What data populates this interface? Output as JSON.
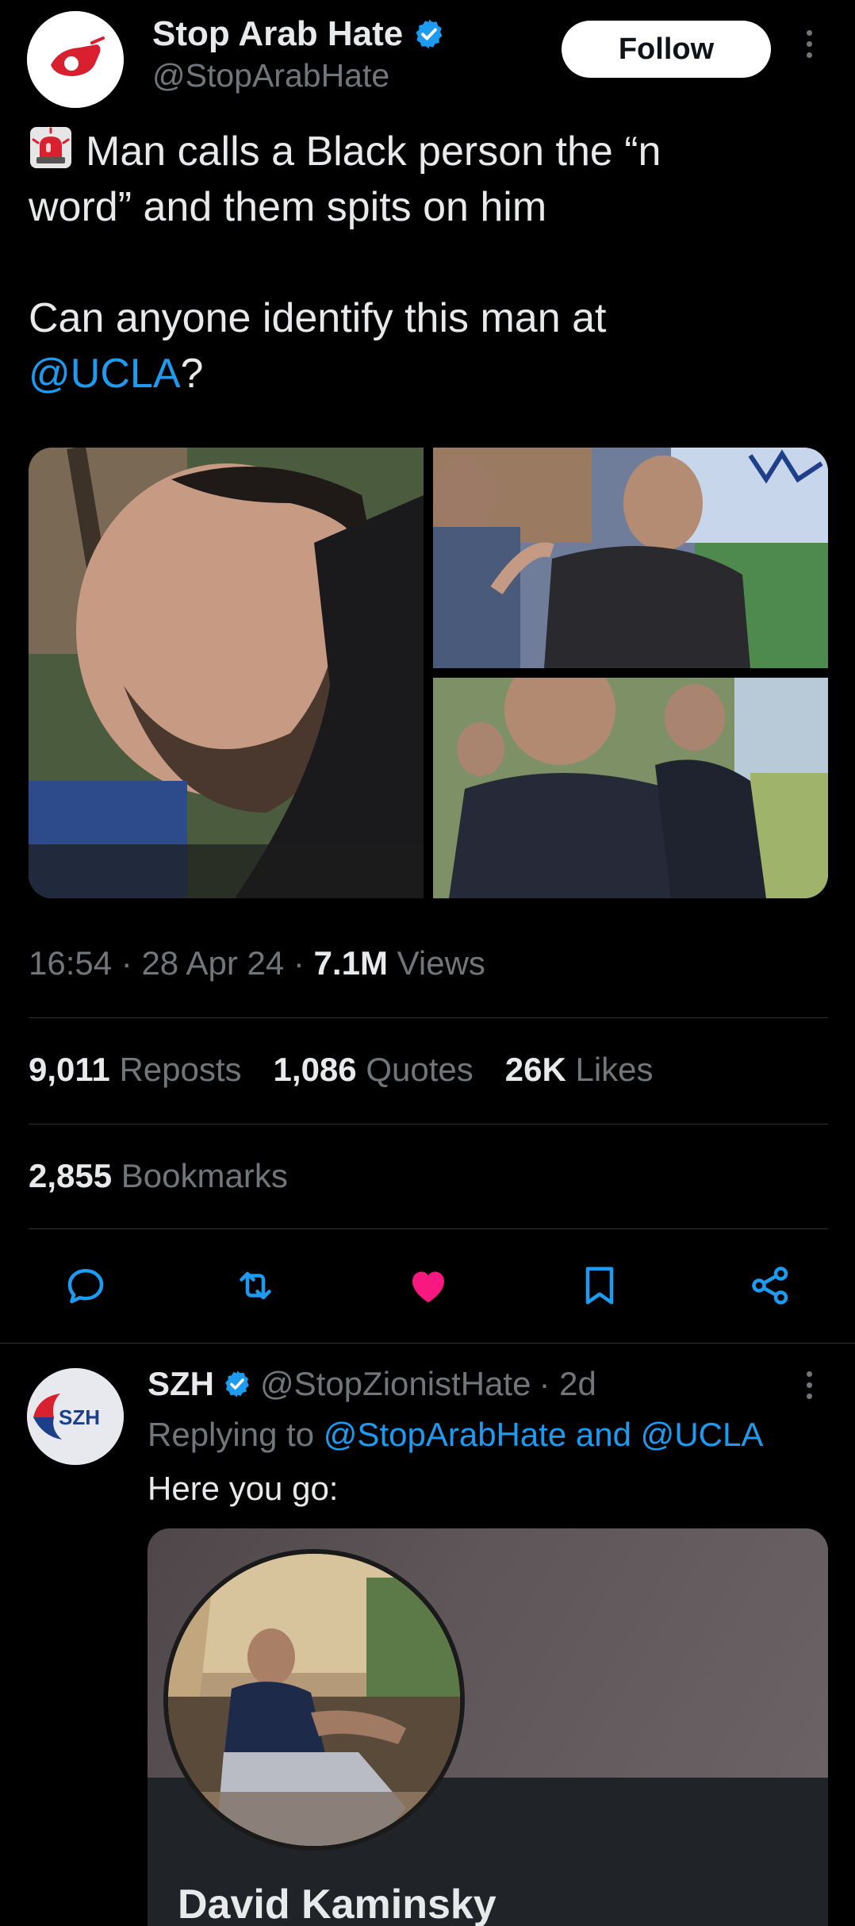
{
  "main_tweet": {
    "author_name": "Stop Arab Hate",
    "author_handle": "@StopArabHate",
    "follow_label": "Follow",
    "text_line1": "Man calls a Black person the “n",
    "text_line2": "word” and them spits on him",
    "text_line3": "Can anyone identify this man at",
    "mention": "@UCLA",
    "mention_suffix": "?",
    "emoji_icon": "police-siren-icon",
    "time": "16:54",
    "date": "28 Apr 24",
    "views_count": "7.1M",
    "views_label": "Views",
    "reposts_count": "9,011",
    "reposts_label": "Reposts",
    "quotes_count": "1,086",
    "quotes_label": "Quotes",
    "likes_count": "26K",
    "likes_label": "Likes",
    "bookmarks_count": "2,855",
    "bookmarks_label": "Bookmarks"
  },
  "actions": [
    {
      "name": "reply",
      "icon": "comment-icon"
    },
    {
      "name": "repost",
      "icon": "repost-icon"
    },
    {
      "name": "like",
      "icon": "heart-icon",
      "active": true
    },
    {
      "name": "bookmark",
      "icon": "bookmark-icon"
    },
    {
      "name": "share",
      "icon": "share-icon"
    }
  ],
  "reply": {
    "author_name": "SZH",
    "author_handle": "@StopZionistHate",
    "age": "· 2d",
    "avatar_text": "SZH",
    "replying_prefix": "Replying to",
    "replying_to": "@StopArabHate and @UCLA",
    "text": "Here you go:",
    "card_name": "David Kaminsky"
  },
  "colors": {
    "background": "#000000",
    "text_primary": "#e7e9ea",
    "text_secondary": "#71767b",
    "link": "#1d9bf0",
    "verified": "#1d9bf0",
    "like_active": "#f91880"
  }
}
